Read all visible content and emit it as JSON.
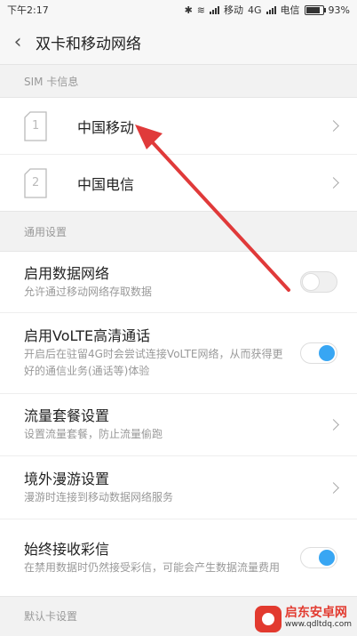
{
  "status_bar": {
    "time": "下午2:17",
    "carrier1": "移动",
    "network": "4G",
    "carrier2": "电信",
    "battery": "93%"
  },
  "header": {
    "title": "双卡和移动网络"
  },
  "sim_section": {
    "label": "SIM 卡信息",
    "cards": [
      {
        "slot": "1",
        "name": "中国移动"
      },
      {
        "slot": "2",
        "name": "中国电信"
      }
    ]
  },
  "general_section": {
    "label": "通用设置",
    "items": [
      {
        "title": "启用数据网络",
        "desc": "允许通过移动网络存取数据",
        "control": "toggle",
        "enabled": false
      },
      {
        "title": "启用VoLTE高清通话",
        "desc": "开启后在驻留4G时会尝试连接VoLTE网络，从而获得更好的通信业务(通话等)体验",
        "control": "toggle",
        "enabled": true
      },
      {
        "title": "流量套餐设置",
        "desc": "设置流量套餐，防止流量偷跑",
        "control": "chevron"
      },
      {
        "title": "境外漫游设置",
        "desc": "漫游时连接到移动数据网络服务",
        "control": "chevron"
      },
      {
        "title": "始终接收彩信",
        "desc": "在禁用数据时仍然接受彩信，可能会产生数据流量费用",
        "control": "toggle",
        "enabled": true
      }
    ]
  },
  "default_section": {
    "label": "默认卡设置"
  },
  "colors": {
    "accent": "#38a6f3",
    "arrow": "#e03a3a"
  },
  "watermark": {
    "name": "启东安卓网",
    "url": "www.qdltdq.com"
  }
}
